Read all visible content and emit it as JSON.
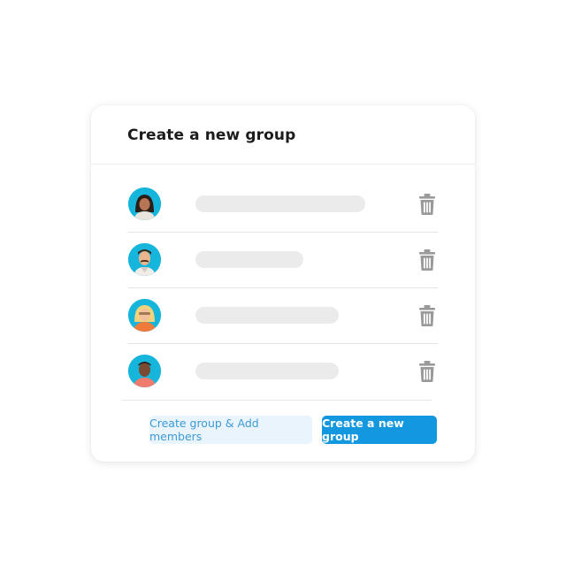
{
  "dialog": {
    "title": "Create a new group"
  },
  "members": [
    {
      "avatar_icon": "avatar-woman-dark-hair-icon"
    },
    {
      "avatar_icon": "avatar-man-mustache-icon"
    },
    {
      "avatar_icon": "avatar-woman-blonde-icon"
    },
    {
      "avatar_icon": "avatar-man-dark-skin-icon"
    }
  ],
  "actions": {
    "secondary_label": "Create group & Add members",
    "primary_label": "Create a new group"
  },
  "colors": {
    "accent": "#1397de",
    "avatar_bg": "#16b6dc",
    "trash": "#9a9a9a",
    "placeholder_bar": "#ebebeb"
  }
}
